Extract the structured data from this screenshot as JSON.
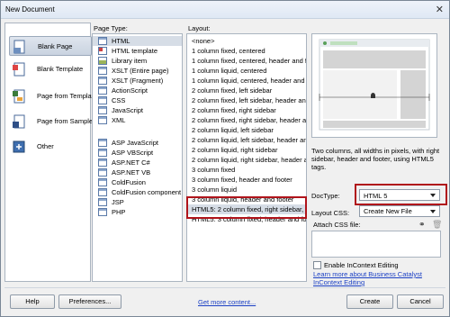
{
  "window": {
    "title": "New Document"
  },
  "categories": [
    {
      "label": "Blank Page",
      "icon": "blank-page-icon",
      "selected": true
    },
    {
      "label": "Blank Template",
      "icon": "blank-template-icon",
      "selected": false
    },
    {
      "label": "Page from Template",
      "icon": "page-from-template-icon",
      "selected": false
    },
    {
      "label": "Page from Sample",
      "icon": "page-from-sample-icon",
      "selected": false
    },
    {
      "label": "Other",
      "icon": "other-icon",
      "selected": false
    }
  ],
  "page_type": {
    "header": "Page Type:",
    "items": [
      {
        "label": "HTML",
        "selected": true
      },
      {
        "label": "HTML template"
      },
      {
        "label": "Library item"
      },
      {
        "label": "XSLT (Entire page)"
      },
      {
        "label": "XSLT (Fragment)"
      },
      {
        "label": "ActionScript"
      },
      {
        "label": "CSS"
      },
      {
        "label": "JavaScript"
      },
      {
        "label": "XML"
      },
      {
        "label": "ASP JavaScript"
      },
      {
        "label": "ASP VBScript"
      },
      {
        "label": "ASP.NET C#"
      },
      {
        "label": "ASP.NET VB"
      },
      {
        "label": "ColdFusion"
      },
      {
        "label": "ColdFusion component"
      },
      {
        "label": "JSP"
      },
      {
        "label": "PHP"
      }
    ]
  },
  "layout": {
    "header": "Layout:",
    "items": [
      {
        "label": "<none>"
      },
      {
        "label": "1 column fixed, centered"
      },
      {
        "label": "1 column fixed, centered, header and footer"
      },
      {
        "label": "1 column liquid, centered"
      },
      {
        "label": "1 column liquid, centered, header and footer"
      },
      {
        "label": "2 column fixed, left sidebar"
      },
      {
        "label": "2 column fixed, left sidebar, header and footer"
      },
      {
        "label": "2 column fixed, right sidebar"
      },
      {
        "label": "2 column fixed, right sidebar, header and footer"
      },
      {
        "label": "2 column liquid, left sidebar"
      },
      {
        "label": "2 column liquid, left sidebar, header and footer"
      },
      {
        "label": "2 column liquid, right sidebar"
      },
      {
        "label": "2 column liquid, right sidebar, header and footer"
      },
      {
        "label": "3 column fixed"
      },
      {
        "label": "3 column fixed, header and footer"
      },
      {
        "label": "3 column liquid"
      },
      {
        "label": "3 column liquid, header and footer"
      },
      {
        "label": "HTML5: 2 column fixed, right sidebar, header and footer",
        "selected": true
      },
      {
        "label": "HTML5: 3 column fixed, header and footer"
      }
    ]
  },
  "description": "Two columns, all widths in pixels, with right sidebar, header and footer, using HTML5 tags.",
  "doctype": {
    "label": "DocType:",
    "value": "HTML 5"
  },
  "layout_css": {
    "label": "Layout CSS:",
    "value": "Create New File"
  },
  "attach_css": {
    "label": "Attach CSS file:"
  },
  "incontext": {
    "label": "Enable InContext Editing",
    "checked": false
  },
  "learn_more": "Learn more about Business Catalyst InContext Editing",
  "buttons": {
    "help": "Help",
    "preferences": "Preferences...",
    "get_more": "Get more content...",
    "create": "Create",
    "cancel": "Cancel"
  },
  "colors": {
    "highlight_red": "#b0141b",
    "link_blue": "#1a3fc4",
    "selection_gray": "#d6dde6"
  }
}
